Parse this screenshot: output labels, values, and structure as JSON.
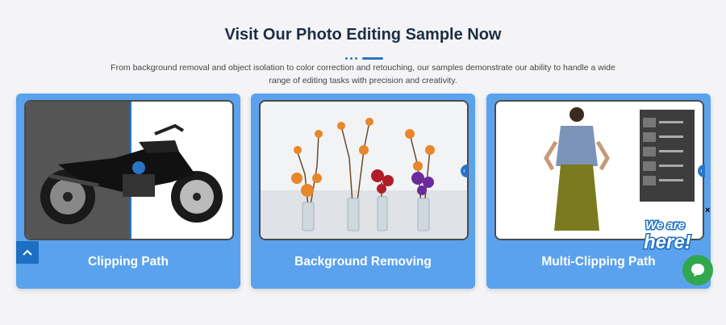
{
  "section": {
    "title": "Visit Our Photo Editing Sample Now",
    "description": "From background removal and object isolation to color correction and retouching, our samples demonstrate our ability to handle a wide range of editing tasks with precision and creativity."
  },
  "cards": [
    {
      "label": "Clipping Path"
    },
    {
      "label": "Background Removing"
    },
    {
      "label": "Multi-Clipping Path"
    }
  ],
  "chat": {
    "badge_line1": "We are",
    "badge_line2": "here!",
    "close": "×"
  },
  "colors": {
    "card_bg": "#5ba2ee",
    "title": "#1d2d44",
    "accent": "#2a74c6",
    "chat_green": "#31a84d"
  },
  "icons": [
    "chevron-up-icon",
    "chevron-left-icon",
    "close-icon",
    "chat-bubble-icon"
  ]
}
